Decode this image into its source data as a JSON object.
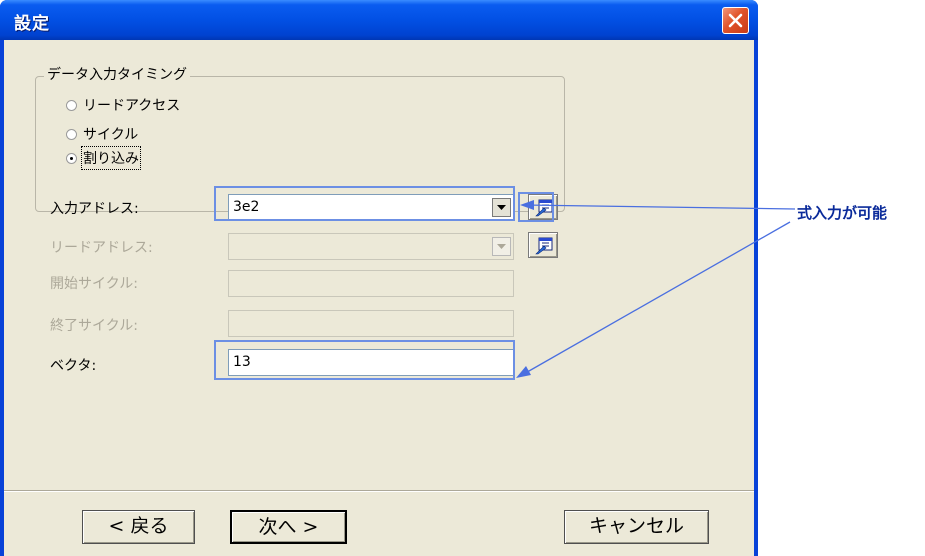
{
  "window": {
    "title": "設定",
    "close_label": "close"
  },
  "group": {
    "title": "データ入力タイミング",
    "options": [
      {
        "label": "リードアクセス",
        "selected": false
      },
      {
        "label": "サイクル",
        "selected": false
      },
      {
        "label": "割り込み",
        "selected": true
      }
    ]
  },
  "fields": {
    "input_address": {
      "label": "入力アドレス:",
      "value": "3e2"
    },
    "read_address": {
      "label": "リードアドレス:",
      "value": ""
    },
    "start_cycle": {
      "label": "開始サイクル:",
      "value": ""
    },
    "end_cycle": {
      "label": "終了サイクル:",
      "value": ""
    },
    "vector": {
      "label": "ベクタ:",
      "value": "13"
    }
  },
  "buttons": {
    "back": "< 戻る",
    "next": "次へ >",
    "cancel": "キャンセル"
  },
  "annotation": {
    "text": "式入力が可能",
    "color": "#4a6fe0"
  },
  "icons": {
    "expression": "expression-input-icon",
    "dropdown": "chevron-down-icon",
    "close": "close-icon"
  },
  "colors": {
    "titlebar": "#0250e4",
    "dialog_bg": "#ece9d8",
    "close_button": "#e0532a",
    "highlight": "#6c8fe4"
  }
}
